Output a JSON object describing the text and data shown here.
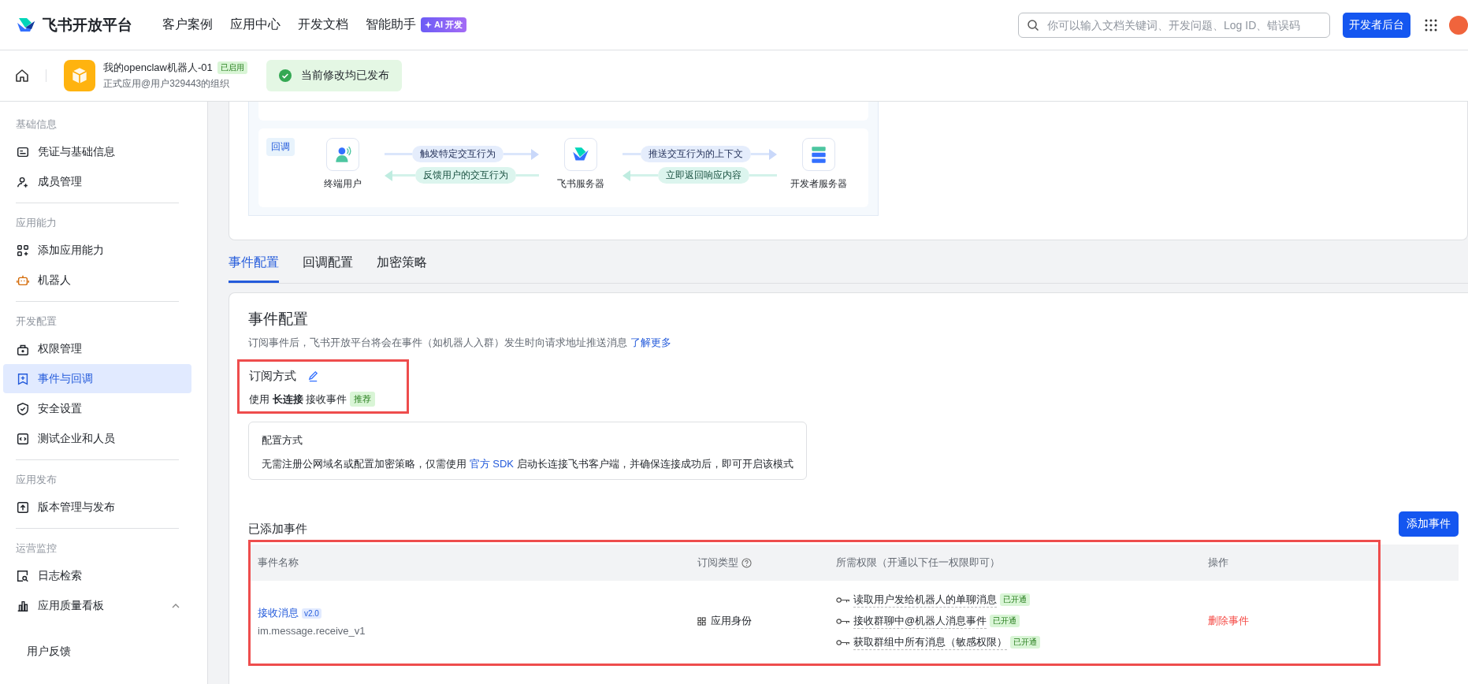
{
  "nav": {
    "logo": "飞书开放平台",
    "links": [
      "客户案例",
      "应用中心",
      "开发文档",
      "智能助手"
    ],
    "ai_badge": "AI 开发",
    "search": {
      "placeholder": "你可以输入文档关键词、开发问题、Log ID、错误码"
    },
    "console_button": "开发者后台"
  },
  "app_header": {
    "name": "我的openclaw机器人-01",
    "status": "已启用",
    "subtitle": "正式应用@用户329443的组织",
    "notice": "当前修改均已发布"
  },
  "sidebar": {
    "groups": [
      {
        "title": "基础信息",
        "items": [
          {
            "label": "凭证与基础信息",
            "selected": false
          },
          {
            "label": "成员管理",
            "selected": false
          }
        ]
      },
      {
        "title": "应用能力",
        "items": [
          {
            "label": "添加应用能力",
            "selected": false
          },
          {
            "label": "机器人",
            "selected": false
          }
        ]
      },
      {
        "title": "开发配置",
        "items": [
          {
            "label": "权限管理",
            "selected": false
          },
          {
            "label": "事件与回调",
            "selected": true
          },
          {
            "label": "安全设置",
            "selected": false
          },
          {
            "label": "测试企业和人员",
            "selected": false
          }
        ]
      },
      {
        "title": "应用发布",
        "items": [
          {
            "label": "版本管理与发布",
            "selected": false
          }
        ]
      },
      {
        "title": "运营监控",
        "items": [
          {
            "label": "日志检索",
            "selected": false
          },
          {
            "label": "应用质量看板",
            "selected": false,
            "expanded": true,
            "children": [
              {
                "label": "用户反馈",
                "selected": false
              }
            ]
          }
        ]
      }
    ]
  },
  "flow": {
    "tag": "回调",
    "nodes": [
      "终端用户",
      "飞书服务器",
      "开发者服务器"
    ],
    "links": [
      {
        "forward": "触发特定交互行为",
        "back": "反馈用户的交互行为"
      },
      {
        "forward": "推送交互行为的上下文",
        "back": "立即返回响应内容"
      }
    ]
  },
  "tabs": [
    {
      "label": "事件配置",
      "selected": true
    },
    {
      "label": "回调配置",
      "selected": false
    },
    {
      "label": "加密策略",
      "selected": false
    }
  ],
  "event_config": {
    "title": "事件配置",
    "description": "订阅事件后，飞书开放平台将会在事件（如机器人入群）发生时向请求地址推送消息",
    "learn_more": "了解更多",
    "subscription": {
      "title": "订阅方式",
      "text": "使用 **长连接** 接收事件",
      "tag": "推荐",
      "highlighted": true
    },
    "mode_box": {
      "title": "配置方式",
      "text_before": "无需注册公网域名或配置加密策略，仅需使用",
      "link": "官方 SDK",
      "text_after": "启动长连接飞书客户端，并确保连接成功后，即可开启该模式"
    },
    "added_title": "已添加事件",
    "add_button": "添加事件"
  },
  "table": {
    "highlighted": true,
    "columns": [
      "事件名称",
      "订阅类型",
      "所需权限（开通以下任一权限即可）",
      "操作"
    ],
    "rows": [
      {
        "name": "接收消息",
        "version": "v2.0",
        "key": "im.message.receive_v1",
        "type": "应用身份",
        "permissions": [
          {
            "label": "读取用户发给机器人的单聊消息",
            "status": "已开通"
          },
          {
            "label": "接收群聊中@机器人消息事件",
            "status": "已开通"
          },
          {
            "label": "获取群组中所有消息（敏感权限）",
            "status": "已开通"
          }
        ],
        "action": "删除事件"
      }
    ]
  }
}
